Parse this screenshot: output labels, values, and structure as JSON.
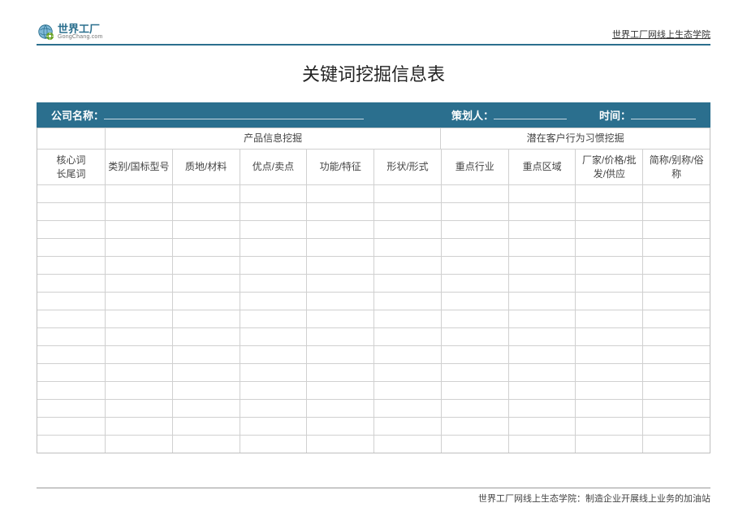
{
  "header": {
    "logo_cn": "世界工厂",
    "logo_en": "GongChang.com",
    "top_right": "世界工厂网线上生态学院"
  },
  "title": "关键词挖掘信息表",
  "infobar": {
    "company_label": "公司名称：",
    "planner_label": "策划人：",
    "time_label": "时间："
  },
  "table": {
    "group1": "产品信息挖掘",
    "group2": "潜在客户行为习惯挖掘",
    "left_top": "核心词",
    "left_bottom": "长尾词",
    "cols": [
      "类别/国标型号",
      "质地/材料",
      "优点/卖点",
      "功能/特征",
      "形状/形式",
      "重点行业",
      "重点区域",
      "厂家/价格/批发/供应",
      "简称/别称/俗称"
    ],
    "body_rows": 15
  },
  "footer": "世界工厂网线上生态学院：制造企业开展线上业务的加油站"
}
